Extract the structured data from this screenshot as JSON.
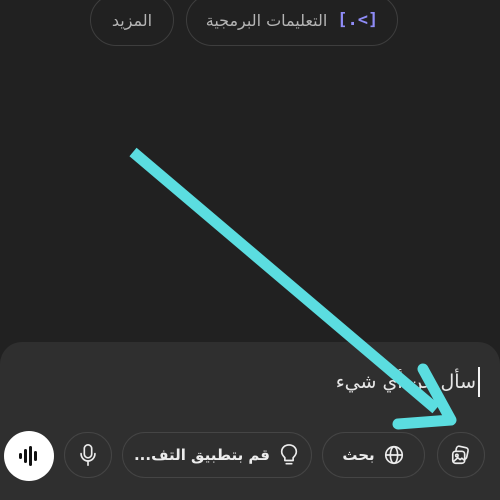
{
  "chips": {
    "code_label": "التعليمات البرمجية",
    "code_icon": "code-bracket-icon",
    "more_label": "المزيد"
  },
  "composer": {
    "input_value": "سأل عن أي شيء",
    "actions": {
      "attach_icon": "image-attach-icon",
      "search_label": "بحث",
      "search_icon": "globe-icon",
      "reason_label": "قم بتطبيق التف...",
      "reason_icon": "lightbulb-icon",
      "mic_icon": "microphone-icon",
      "voice_icon": "voice-waveform-icon"
    }
  },
  "overlay": {
    "arrow_color": "#5bdde0",
    "arrow_icon": "pointer-arrow-icon"
  },
  "colors": {
    "background": "#212121",
    "composer": "#2f2f2f",
    "code_accent": "#8f8cf7"
  }
}
